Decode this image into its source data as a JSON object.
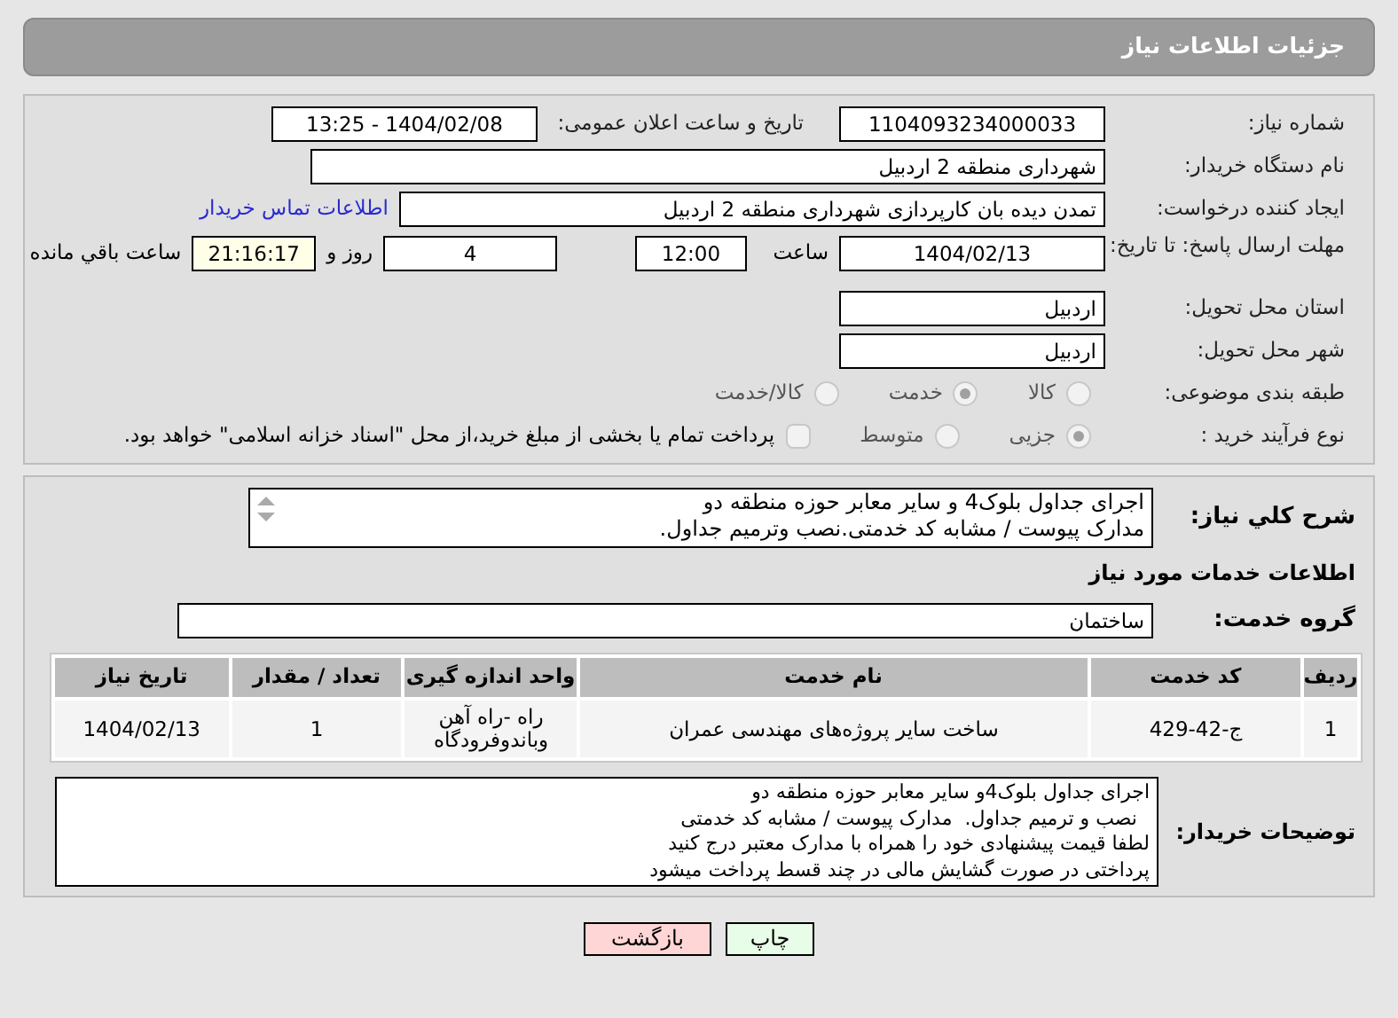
{
  "header": {
    "title": "جزئیات اطلاعات نیاز"
  },
  "need_number": {
    "label": "شماره نیاز:",
    "value": "1104093234000033"
  },
  "announce": {
    "label": "تاریخ و ساعت اعلان عمومی:",
    "value": "1404/02/08 - 13:25"
  },
  "buyer": {
    "label": "نام دستگاه خریدار:",
    "value": "شهرداری منطقه 2 اردبیل"
  },
  "creator": {
    "label": "ایجاد کننده درخواست:",
    "value": "تمدن دیده بان کارپردازی شهرداری منطقه 2 اردبیل",
    "link": "اطلاعات تماس خریدار"
  },
  "deadline": {
    "label": "مهلت ارسال پاسخ: تا تاریخ:",
    "date": "1404/02/13",
    "time_label": "ساعت",
    "time": "12:00",
    "days": "4",
    "days_label": "روز و",
    "remaining": "21:16:17",
    "remaining_label": "ساعت باقي مانده"
  },
  "province": {
    "label": "استان محل تحویل:",
    "value": "اردبیل"
  },
  "city": {
    "label": "شهر محل تحویل:",
    "value": "اردبیل"
  },
  "category": {
    "label": "طبقه بندی موضوعی:",
    "options": [
      {
        "label": "کالا",
        "selected": false
      },
      {
        "label": "خدمت",
        "selected": true
      },
      {
        "label": "کالا/خدمت",
        "selected": false
      }
    ]
  },
  "process": {
    "label": "نوع فرآیند خرید :",
    "options": [
      {
        "label": "جزیی",
        "selected": true
      },
      {
        "label": "متوسط",
        "selected": false
      }
    ],
    "payment": {
      "checked": false,
      "label": "پرداخت تمام یا بخشی از مبلغ خرید،از محل \"اسناد خزانه اسلامی\" خواهد بود."
    }
  },
  "description": {
    "label": "شرح کلي نياز:",
    "lines": [
      "اجرای جداول بلوک4 و سایر معابر حوزه منطقه دو",
      "مدارک پیوست / مشابه کد خدمتی.نصب وترمیم جداول."
    ]
  },
  "services_heading": "اطلاعات خدمات مورد نياز",
  "service_group": {
    "label": "گروه خدمت:",
    "value": "ساختمان"
  },
  "table": {
    "columns": [
      "ردیف",
      "کد خدمت",
      "نام خدمت",
      "واحد اندازه گیری",
      "تعداد / مقدار",
      "تاریخ نیاز"
    ],
    "rows": [
      [
        "1",
        "ج-42-429",
        "ساخت سایر پروژه‌های مهندسی عمران",
        "راه -راه آهن وباندوفرودگاه",
        "1",
        "1404/02/13"
      ]
    ]
  },
  "buyer_notes": {
    "label": "توضیحات خریدار:",
    "lines": [
      "اجرای جداول بلوک4و سایر معابر حوزه منطقه دو",
      "  نصب و ترمیم جداول.  مدارک پیوست / مشابه کد خدمتی",
      "لطفا قیمت پیشنهادی خود را همراه با مدارک معتبر درج کنید",
      "پرداختی در صورت گشایش مالی در چند قسط پرداخت میشود"
    ]
  },
  "buttons": [
    {
      "kind": "print",
      "label": "چاپ"
    },
    {
      "kind": "back",
      "label": "بازگشت"
    }
  ]
}
